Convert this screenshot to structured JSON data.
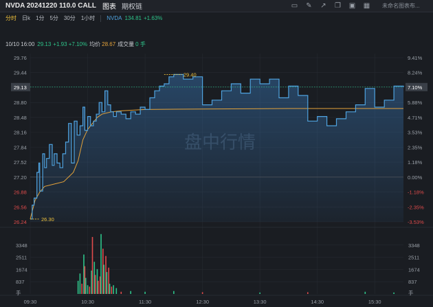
{
  "window": {
    "title": "NVDA 20241220 110.0 CALL",
    "tabs": [
      {
        "label": "图表",
        "active": true
      },
      {
        "label": "期权链",
        "active": false
      }
    ],
    "icons": [
      "screen-icon",
      "brush-icon",
      "share-icon",
      "copy-icon",
      "window-icon",
      "layout-icon"
    ],
    "layout_name": "未命名图表布..."
  },
  "toolbar": {
    "periods": [
      {
        "label": "分时",
        "active": true
      },
      {
        "label": "日k",
        "active": false
      },
      {
        "label": "1分",
        "active": false
      },
      {
        "label": "5分",
        "active": false
      },
      {
        "label": "30分",
        "active": false
      },
      {
        "label": "1小时",
        "active": false
      }
    ],
    "compare": {
      "ticker": "NVDA",
      "price": "134.81",
      "change": "+1.63%"
    }
  },
  "info": {
    "time": "10/10 16:00",
    "price": "29.13",
    "change": "+1.93 +7.10%",
    "avg_label": "均价",
    "avg": "28.67",
    "vol_label": "成交量",
    "vol": "0 手"
  },
  "watermark": "盘中行情",
  "colors": {
    "up": "#2ec48a",
    "down": "#e04b4b",
    "price_line": "#4fa3e0",
    "avg_line": "#e5a33a",
    "highlight": "#f0c23b",
    "background": "#1a1d22"
  },
  "chart_data": {
    "type": "line",
    "prev_close": 27.2,
    "y_ticks_left": [
      "29.76",
      "29.44",
      "29.13",
      "28.80",
      "28.48",
      "28.16",
      "27.84",
      "27.52",
      "27.20",
      "26.88",
      "26.56",
      "26.24"
    ],
    "y_ticks_right": [
      "9.41%",
      "8.24%",
      "7.10%",
      "5.88%",
      "4.71%",
      "3.53%",
      "2.35%",
      "1.18%",
      "0.00%",
      "-1.18%",
      "-2.35%",
      "-3.53%"
    ],
    "x_ticks": [
      "09:30",
      "10:30",
      "11:30",
      "12:30",
      "13:30",
      "14:30",
      "15:30"
    ],
    "current_price": "29.13",
    "current_change": "7.10%",
    "high_label": "29.40",
    "low_label": "26.30",
    "volume_ticks": [
      "3348",
      "2511",
      "1674",
      "837",
      "手"
    ],
    "price_series": [
      {
        "t": "09:30",
        "v": 26.3
      },
      {
        "t": "09:32",
        "v": 26.6
      },
      {
        "t": "09:34",
        "v": 26.75
      },
      {
        "t": "09:37",
        "v": 27.3
      },
      {
        "t": "09:39",
        "v": 27.5
      },
      {
        "t": "09:40",
        "v": 26.9
      },
      {
        "t": "09:43",
        "v": 27.7
      },
      {
        "t": "09:45",
        "v": 27.4
      },
      {
        "t": "09:47",
        "v": 27.6
      },
      {
        "t": "09:50",
        "v": 27.9
      },
      {
        "t": "09:53",
        "v": 27.45
      },
      {
        "t": "09:55",
        "v": 27.7
      },
      {
        "t": "09:58",
        "v": 27.5
      },
      {
        "t": "10:01",
        "v": 27.4
      },
      {
        "t": "10:04",
        "v": 27.7
      },
      {
        "t": "10:07",
        "v": 27.95
      },
      {
        "t": "10:10",
        "v": 28.35
      },
      {
        "t": "10:13",
        "v": 27.5
      },
      {
        "t": "10:16",
        "v": 28.4
      },
      {
        "t": "10:19",
        "v": 28.1
      },
      {
        "t": "10:22",
        "v": 28.3
      },
      {
        "t": "10:25",
        "v": 28.7
      },
      {
        "t": "10:27",
        "v": 28.2
      },
      {
        "t": "10:30",
        "v": 28.5
      },
      {
        "t": "10:33",
        "v": 28.3
      },
      {
        "t": "10:36",
        "v": 28.4
      },
      {
        "t": "10:39",
        "v": 28.55
      },
      {
        "t": "10:42",
        "v": 28.8
      },
      {
        "t": "10:45",
        "v": 28.6
      },
      {
        "t": "10:48",
        "v": 29.05
      },
      {
        "t": "10:51",
        "v": 28.75
      },
      {
        "t": "10:54",
        "v": 28.6
      },
      {
        "t": "10:57",
        "v": 28.5
      },
      {
        "t": "11:00",
        "v": 28.6
      },
      {
        "t": "11:05",
        "v": 28.55
      },
      {
        "t": "11:10",
        "v": 28.45
      },
      {
        "t": "11:15",
        "v": 28.6
      },
      {
        "t": "11:20",
        "v": 28.55
      },
      {
        "t": "11:25",
        "v": 28.7
      },
      {
        "t": "11:30",
        "v": 28.65
      },
      {
        "t": "11:35",
        "v": 28.9
      },
      {
        "t": "11:40",
        "v": 29.05
      },
      {
        "t": "11:45",
        "v": 29.15
      },
      {
        "t": "11:50",
        "v": 29.2
      },
      {
        "t": "11:55",
        "v": 29.35
      },
      {
        "t": "12:00",
        "v": 29.4
      },
      {
        "t": "12:10",
        "v": 29.3
      },
      {
        "t": "12:20",
        "v": 29.35
      },
      {
        "t": "12:30",
        "v": 28.75
      },
      {
        "t": "12:40",
        "v": 28.85
      },
      {
        "t": "12:50",
        "v": 29.05
      },
      {
        "t": "13:00",
        "v": 29.2
      },
      {
        "t": "13:10",
        "v": 29.0
      },
      {
        "t": "13:20",
        "v": 29.3
      },
      {
        "t": "13:30",
        "v": 29.2
      },
      {
        "t": "13:40",
        "v": 29.3
      },
      {
        "t": "13:50",
        "v": 28.9
      },
      {
        "t": "14:00",
        "v": 29.15
      },
      {
        "t": "14:10",
        "v": 28.95
      },
      {
        "t": "14:20",
        "v": 28.4
      },
      {
        "t": "14:30",
        "v": 28.5
      },
      {
        "t": "14:40",
        "v": 28.3
      },
      {
        "t": "14:50",
        "v": 28.45
      },
      {
        "t": "15:00",
        "v": 28.6
      },
      {
        "t": "15:10",
        "v": 28.75
      },
      {
        "t": "15:20",
        "v": 29.1
      },
      {
        "t": "15:30",
        "v": 28.7
      },
      {
        "t": "15:40",
        "v": 28.85
      },
      {
        "t": "15:50",
        "v": 29.15
      },
      {
        "t": "16:00",
        "v": 29.13
      }
    ],
    "avg_series": [
      {
        "t": "09:30",
        "v": 26.3
      },
      {
        "t": "09:35",
        "v": 26.7
      },
      {
        "t": "09:40",
        "v": 26.88
      },
      {
        "t": "09:45",
        "v": 27.0
      },
      {
        "t": "09:55",
        "v": 27.05
      },
      {
        "t": "10:05",
        "v": 27.1
      },
      {
        "t": "10:15",
        "v": 27.3
      },
      {
        "t": "10:20",
        "v": 27.55
      },
      {
        "t": "10:25",
        "v": 28.0
      },
      {
        "t": "10:30",
        "v": 28.22
      },
      {
        "t": "10:35",
        "v": 28.35
      },
      {
        "t": "10:40",
        "v": 28.48
      },
      {
        "t": "10:45",
        "v": 28.55
      },
      {
        "t": "10:55",
        "v": 28.6
      },
      {
        "t": "11:05",
        "v": 28.62
      },
      {
        "t": "11:30",
        "v": 28.65
      },
      {
        "t": "12:30",
        "v": 28.66
      },
      {
        "t": "14:00",
        "v": 28.67
      },
      {
        "t": "16:00",
        "v": 28.67
      }
    ],
    "volume": [
      {
        "t": "10:20",
        "v": 900,
        "c": "up"
      },
      {
        "t": "10:22",
        "v": 1400,
        "c": "up"
      },
      {
        "t": "10:24",
        "v": 700,
        "c": "down"
      },
      {
        "t": "10:26",
        "v": 2700,
        "c": "up"
      },
      {
        "t": "10:27",
        "v": 1900,
        "c": "down"
      },
      {
        "t": "10:28",
        "v": 1100,
        "c": "up"
      },
      {
        "t": "10:30",
        "v": 600,
        "c": "up"
      },
      {
        "t": "10:32",
        "v": 500,
        "c": "down"
      },
      {
        "t": "10:34",
        "v": 1600,
        "c": "up"
      },
      {
        "t": "10:35",
        "v": 3900,
        "c": "down"
      },
      {
        "t": "10:37",
        "v": 2200,
        "c": "up"
      },
      {
        "t": "10:38",
        "v": 1300,
        "c": "down"
      },
      {
        "t": "10:40",
        "v": 1700,
        "c": "up"
      },
      {
        "t": "10:41",
        "v": 900,
        "c": "down"
      },
      {
        "t": "10:43",
        "v": 1200,
        "c": "down"
      },
      {
        "t": "10:44",
        "v": 4100,
        "c": "up"
      },
      {
        "t": "10:46",
        "v": 3100,
        "c": "down"
      },
      {
        "t": "10:47",
        "v": 2000,
        "c": "up"
      },
      {
        "t": "10:49",
        "v": 2600,
        "c": "down"
      },
      {
        "t": "10:50",
        "v": 1500,
        "c": "up"
      },
      {
        "t": "10:52",
        "v": 1800,
        "c": "down"
      },
      {
        "t": "10:53",
        "v": 700,
        "c": "up"
      },
      {
        "t": "10:55",
        "v": 500,
        "c": "down"
      },
      {
        "t": "10:57",
        "v": 600,
        "c": "up"
      },
      {
        "t": "11:00",
        "v": 400,
        "c": "up"
      },
      {
        "t": "11:05",
        "v": 150,
        "c": "down"
      },
      {
        "t": "11:15",
        "v": 200,
        "c": "up"
      },
      {
        "t": "11:30",
        "v": 150,
        "c": "up"
      },
      {
        "t": "12:00",
        "v": 200,
        "c": "up"
      },
      {
        "t": "12:30",
        "v": 120,
        "c": "down"
      },
      {
        "t": "13:30",
        "v": 100,
        "c": "up"
      },
      {
        "t": "14:20",
        "v": 120,
        "c": "down"
      },
      {
        "t": "15:20",
        "v": 150,
        "c": "up"
      },
      {
        "t": "15:50",
        "v": 100,
        "c": "up"
      }
    ]
  }
}
